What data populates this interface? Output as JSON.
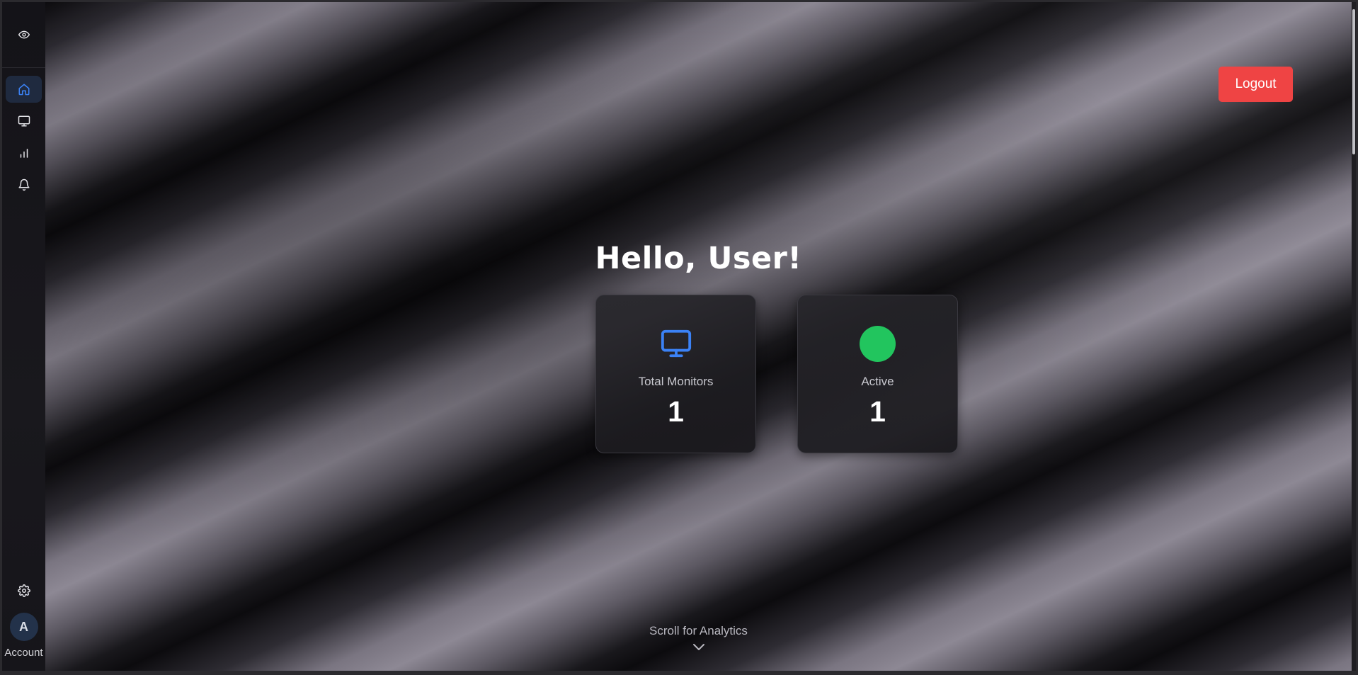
{
  "sidebar": {
    "logo_icon": "eye-icon",
    "nav": [
      {
        "name": "home",
        "icon": "home-icon",
        "active": true
      },
      {
        "name": "monitors",
        "icon": "monitor-icon",
        "active": false
      },
      {
        "name": "analytics",
        "icon": "bar-chart-icon",
        "active": false
      },
      {
        "name": "alerts",
        "icon": "bell-icon",
        "active": false
      }
    ],
    "settings_icon": "gear-icon",
    "account": {
      "avatar_initial": "A",
      "label": "Account"
    }
  },
  "header": {
    "logout_label": "Logout"
  },
  "main": {
    "greeting": "Hello, User!",
    "cards": [
      {
        "label": "Total Monitors",
        "value": "1",
        "icon": "monitor-icon"
      },
      {
        "label": "Active",
        "value": "1",
        "icon": "status-dot"
      }
    ],
    "scroll_hint": "Scroll for Analytics"
  },
  "colors": {
    "accent_blue": "#3b82f6",
    "active_green": "#22c55e",
    "logout_red": "#ef4444"
  }
}
